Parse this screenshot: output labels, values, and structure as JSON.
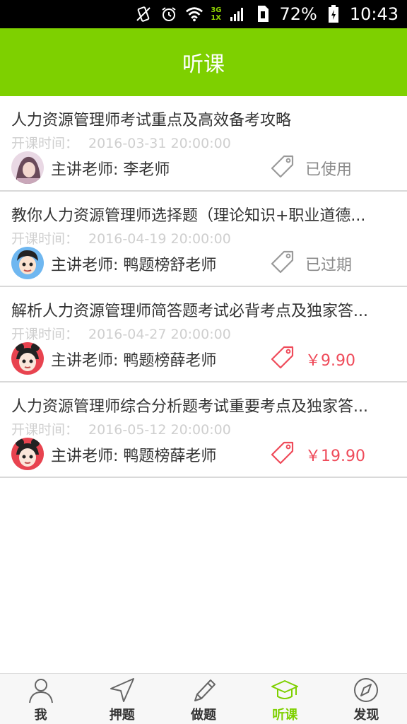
{
  "status_bar": {
    "network_top": "3G",
    "network_bottom": "1X",
    "battery": "72%",
    "time": "10:43"
  },
  "header": {
    "title": "听课"
  },
  "colors": {
    "accent": "#7ed000",
    "price": "#ef4b5a",
    "muted": "#8a8a8a",
    "time": "#cfcfcf"
  },
  "courses": [
    {
      "title": "人力资源管理师考试重点及高效备考攻略",
      "time_label": "开课时间：",
      "time_value": "2016-03-31 20:00:00",
      "teacher": "主讲老师: 李老师",
      "status": "已使用",
      "status_type": "used"
    },
    {
      "title": "教你人力资源管理师选择题（理论知识+职业道德...",
      "time_label": "开课时间：",
      "time_value": "2016-04-19 20:00:00",
      "teacher": "主讲老师: 鸭题榜舒老师",
      "status": "已过期",
      "status_type": "expired"
    },
    {
      "title": "解析人力资源管理师简答题考试必背考点及独家答...",
      "time_label": "开课时间：",
      "time_value": "2016-04-27 20:00:00",
      "teacher": "主讲老师: 鸭题榜薛老师",
      "status": "￥9.90",
      "status_type": "price"
    },
    {
      "title": "人力资源管理师综合分析题考试重要考点及独家答...",
      "time_label": "开课时间：",
      "time_value": "2016-05-12 20:00:00",
      "teacher": "主讲老师: 鸭题榜薛老师",
      "status": "￥19.90",
      "status_type": "price"
    }
  ],
  "tabs": [
    {
      "label": "我",
      "icon": "person-icon"
    },
    {
      "label": "押题",
      "icon": "navigation-arrow-icon"
    },
    {
      "label": "做题",
      "icon": "pencil-icon"
    },
    {
      "label": "听课",
      "icon": "graduation-cap-icon",
      "active": true
    },
    {
      "label": "发现",
      "icon": "compass-icon"
    }
  ]
}
